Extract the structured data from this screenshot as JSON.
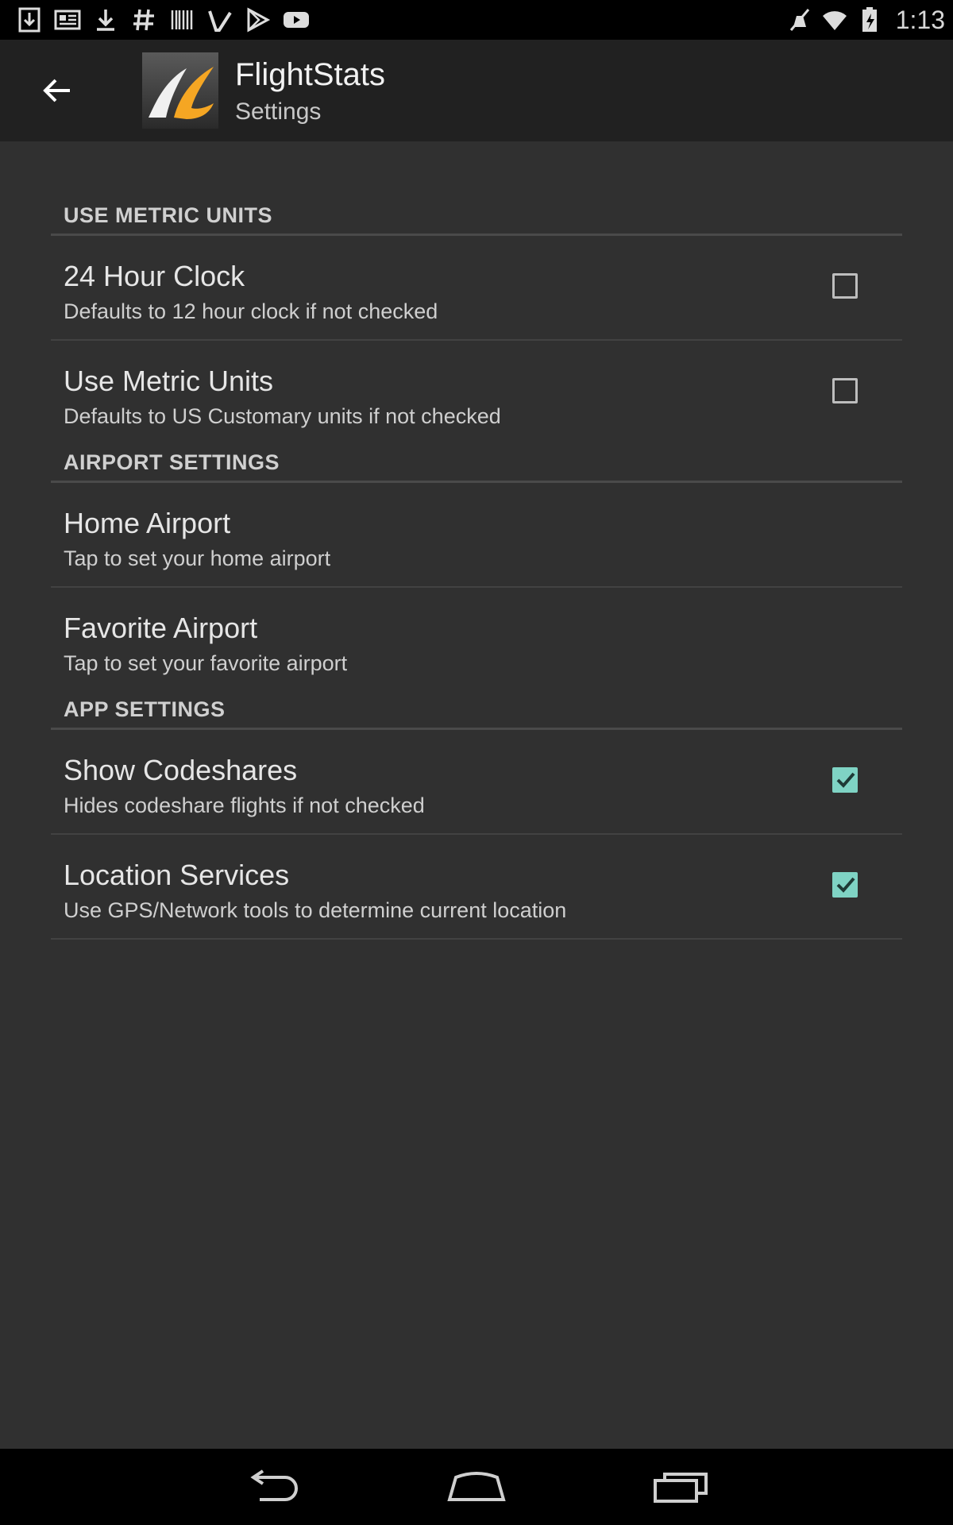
{
  "status_bar": {
    "time": "1:13",
    "left_icons": [
      "download-icon",
      "news-icon",
      "download-icon",
      "hash-icon",
      "barcode-icon",
      "check-icon",
      "play-store-icon",
      "youtube-icon"
    ],
    "right_icons": [
      "mute-icon",
      "wifi-icon",
      "battery-icon"
    ]
  },
  "action_bar": {
    "title": "FlightStats",
    "subtitle": "Settings",
    "accent": "#f5a623"
  },
  "sections": [
    {
      "header": "USE METRIC UNITS",
      "items": [
        {
          "title": "24 Hour Clock",
          "summary": "Defaults to 12 hour clock if not checked",
          "checked": false
        },
        {
          "title": "Use Metric Units",
          "summary": "Defaults to US Customary units if not checked",
          "checked": false
        }
      ]
    },
    {
      "header": "AIRPORT SETTINGS",
      "items": [
        {
          "title": "Home Airport",
          "summary": "Tap to set your home airport"
        },
        {
          "title": "Favorite Airport",
          "summary": "Tap to set your favorite airport"
        }
      ]
    },
    {
      "header": "APP SETTINGS",
      "items": [
        {
          "title": "Show Codeshares",
          "summary": "Hides codeshare flights if not checked",
          "checked": true
        },
        {
          "title": "Location Services",
          "summary": "Use GPS/Network tools to determine current location",
          "checked": true
        }
      ]
    }
  ],
  "colors": {
    "checkbox_checked": "#7fd3c4",
    "background": "#303030",
    "action_bar": "#212121"
  }
}
